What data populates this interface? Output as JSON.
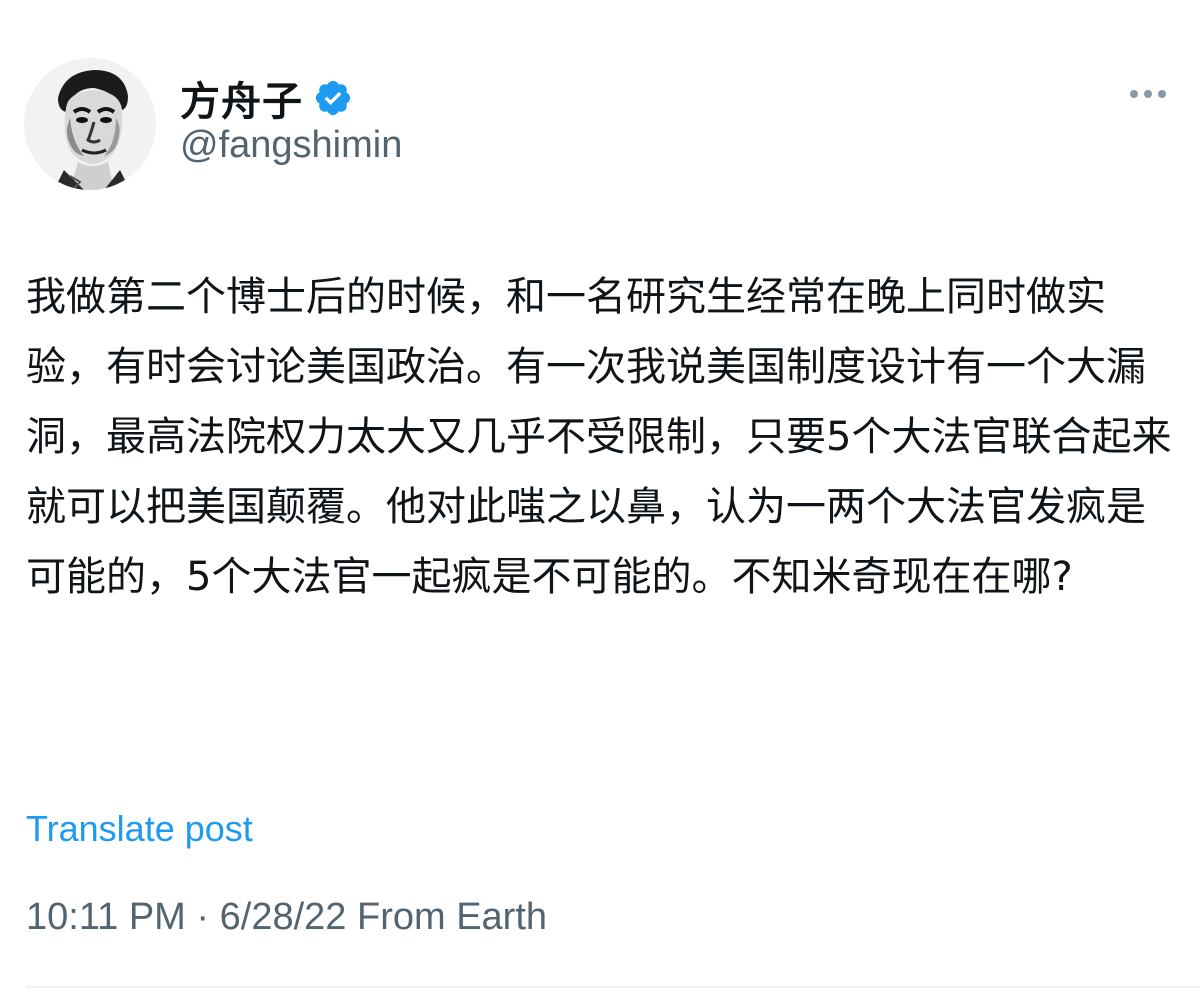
{
  "author": {
    "display_name": "方舟子",
    "handle": "@fangshimin",
    "verified": true,
    "verified_icon": "verified-badge-icon",
    "avatar_icon": "avatar-photo"
  },
  "menu": {
    "more_icon": "more-horizontal-icon"
  },
  "post": {
    "text": "我做第二个博士后的时候，和一名研究生经常在晚上同时做实验，有时会讨论美国政治。有一次我说美国制度设计有一个大漏洞，最高法院权力太大又几乎不受限制，只要5个大法官联合起来就可以把美国颠覆。他对此嗤之以鼻，认为一两个大法官发疯是可能的，5个大法官一起疯是不可能的。不知米奇现在在哪?"
  },
  "actions": {
    "translate_label": "Translate post"
  },
  "meta": {
    "time": "10:11 PM",
    "separator": " · ",
    "date": "6/28/22",
    "source": " From Earth"
  },
  "colors": {
    "accent": "#1d9bf0",
    "secondary_text": "#536471",
    "primary_text": "#0f1419"
  }
}
